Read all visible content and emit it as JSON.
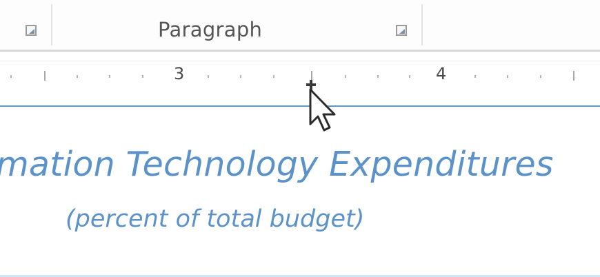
{
  "ribbon": {
    "group_label": "Paragraph"
  },
  "ruler": {
    "labels": [
      "3",
      "4"
    ]
  },
  "document": {
    "heading": "mation Technology Expenditures",
    "subheading": "(percent of total budget)"
  },
  "colors": {
    "heading_text": "#5b92c9",
    "accent_rule": "#5b9bc8"
  },
  "icons": {
    "dialog_launcher": "dialog-launcher-icon",
    "tab_stop": "tab-stop-marker-icon",
    "pointer": "mouse-pointer-icon"
  }
}
